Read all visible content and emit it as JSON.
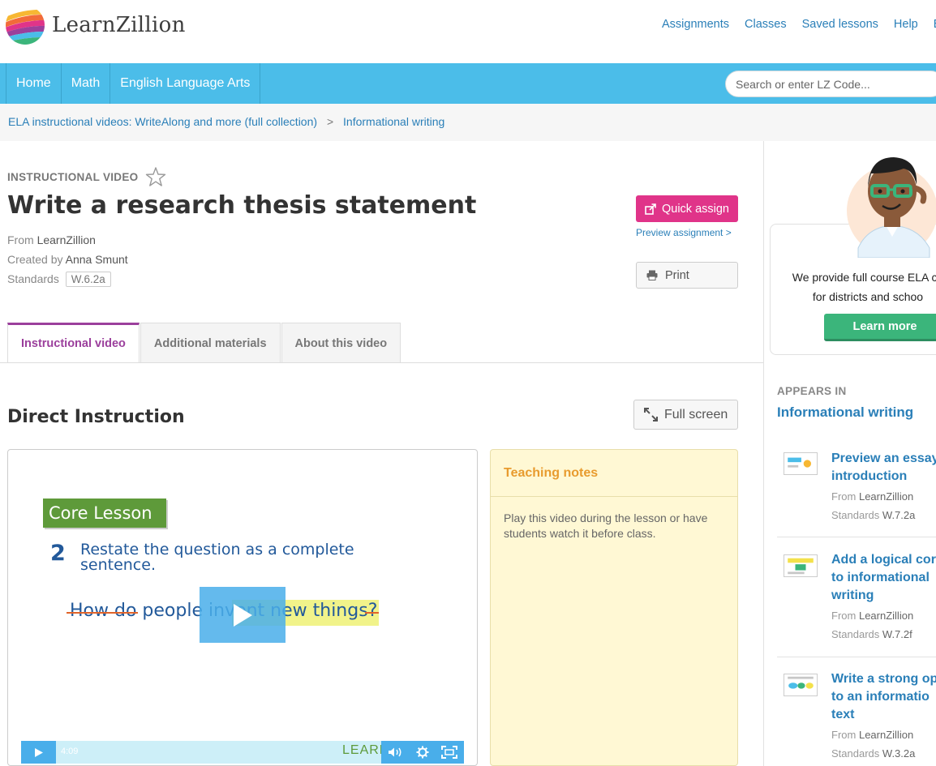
{
  "brand": {
    "name": "LearnZillion"
  },
  "top_nav": {
    "links": [
      "Assignments",
      "Classes",
      "Saved lessons",
      "Help",
      "E"
    ]
  },
  "main_nav": {
    "items": [
      "Home",
      "Math",
      "English Language Arts"
    ]
  },
  "search": {
    "placeholder": "Search or enter LZ Code..."
  },
  "breadcrumb": {
    "items": [
      "ELA instructional videos: WriteAlong and more (full collection)",
      "Informational writing"
    ],
    "separator": ">"
  },
  "lesson": {
    "kicker": "INSTRUCTIONAL VIDEO",
    "title": "Write a research thesis statement",
    "from_label": "From",
    "from_value": "LearnZillion",
    "created_label": "Created by",
    "created_value": "Anna Smunt",
    "standards_label": "Standards",
    "standards_value": "W.6.2a"
  },
  "actions": {
    "quick_assign": "Quick assign",
    "preview_assignment": "Preview assignment >",
    "print": "Print"
  },
  "tabs": [
    "Instructional video",
    "Additional materials",
    "About this video"
  ],
  "section": {
    "title": "Direct Instruction",
    "fullscreen": "Full screen"
  },
  "video": {
    "badge": "Core Lesson",
    "step_number": "2",
    "step_text": "Restate the question as a complete sentence.",
    "question_struck": "How do",
    "question_rest": "people invent new things",
    "question_struck_end": "?",
    "time": "4:09",
    "watermark": "LEARN"
  },
  "notes": {
    "title": "Teaching notes",
    "body": "Play this video during the lesson or have students watch it before class."
  },
  "promo": {
    "line1": "We provide full course ELA cu",
    "line2": "for districts and schoo",
    "button": "Learn more"
  },
  "appears_in": {
    "label": "APPEARS IN",
    "link": "Informational writing"
  },
  "related": [
    {
      "title_lines": [
        "Preview an essay",
        "introduction"
      ],
      "from_label": "From",
      "from": "LearnZillion",
      "std_label": "Standards",
      "std": "W.7.2a"
    },
    {
      "title_lines": [
        "Add a logical cor",
        "to informational",
        "writing"
      ],
      "from_label": "From",
      "from": "LearnZillion",
      "std_label": "Standards",
      "std": "W.7.2f"
    },
    {
      "title_lines": [
        "Write a strong op",
        "to an informatio",
        "text"
      ],
      "from_label": "From",
      "from": "LearnZillion",
      "std_label": "Standards",
      "std": "W.3.2a"
    }
  ],
  "colors": {
    "nav_blue": "#4bbde9",
    "link_blue": "#2a7fb8",
    "assign_pink": "#e03489",
    "tab_purple": "#9b3f9c",
    "learn_more_green": "#3bb57b",
    "notes_orange": "#e89b2e"
  },
  "icons": [
    "logo-mark",
    "star-icon",
    "share-icon",
    "printer-icon",
    "expand-icon",
    "play-icon",
    "volume-icon",
    "gear-icon",
    "fullscreen-icon"
  ]
}
